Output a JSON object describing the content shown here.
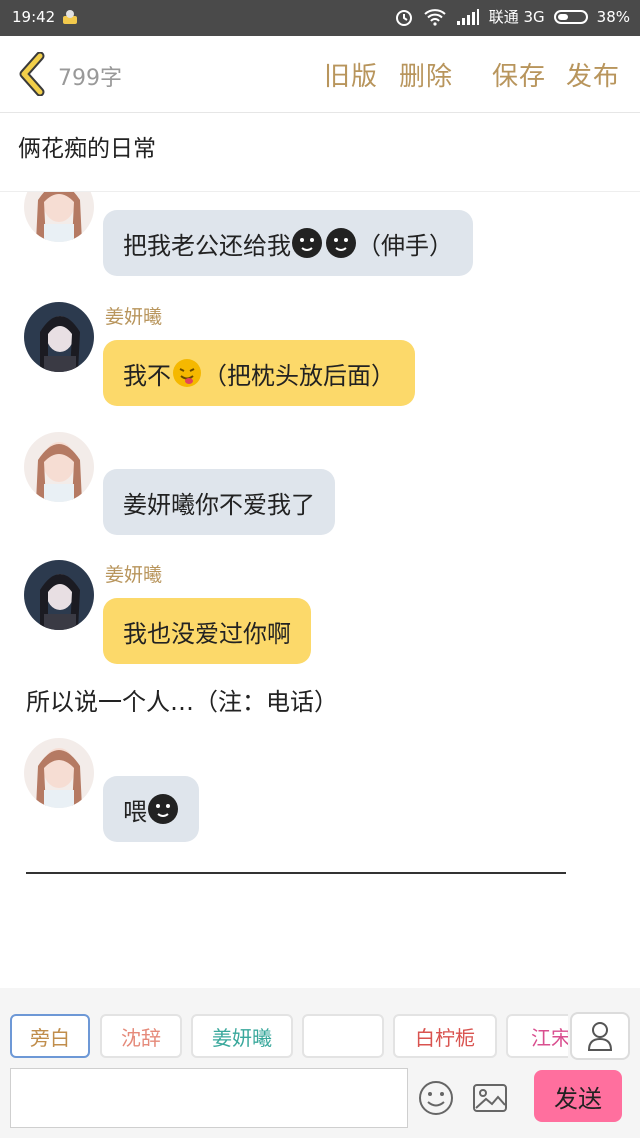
{
  "status_bar": {
    "time": "19:42",
    "carrier": "联通 3G",
    "battery": "38%",
    "battery_level": 0.38
  },
  "header": {
    "word_count": "799字",
    "old_version": "旧版",
    "delete": "删除",
    "save": "保存",
    "publish": "发布"
  },
  "story": {
    "title": "俩花痴的日常"
  },
  "messages": [
    {
      "speaker": "",
      "text": "把我老公还给我",
      "suffix": "（伸手）",
      "emoji": [
        "black-smiley-icon",
        "black-smiley-icon"
      ],
      "style": "gray"
    },
    {
      "speaker": "姜妍曦",
      "text": "我不",
      "suffix": "（把枕头放后面）",
      "emoji": [
        "tongue-emoji-icon"
      ],
      "style": "yellow"
    },
    {
      "speaker": "",
      "text": "姜妍曦你不爱我了",
      "style": "gray"
    },
    {
      "speaker": "姜妍曦",
      "text": "我也没爱过你啊",
      "style": "yellow"
    },
    {
      "speaker": "",
      "text": "喂",
      "emoji": [
        "black-smiley-icon"
      ],
      "style": "gray"
    }
  ],
  "narration": "所以说一个人…（注：电话）",
  "roles": [
    {
      "label": "旁白",
      "color": "#c08d4b",
      "active": true
    },
    {
      "label": "沈辞",
      "color": "#e58a7a"
    },
    {
      "label": "姜妍曦",
      "color": "#3aa89c"
    },
    {
      "label": "",
      "color": "#a46dc7"
    },
    {
      "label": "白柠栀",
      "color": "#d9534f"
    },
    {
      "label": "江宋",
      "color": "#d94f8f"
    }
  ],
  "composer": {
    "input_value": "",
    "send_label": "发送"
  },
  "colors": {
    "accent": "#b8955c",
    "send": "#ff6f9e",
    "bubble_gray": "#dfe5ec",
    "bubble_yellow": "#fcd96a"
  }
}
